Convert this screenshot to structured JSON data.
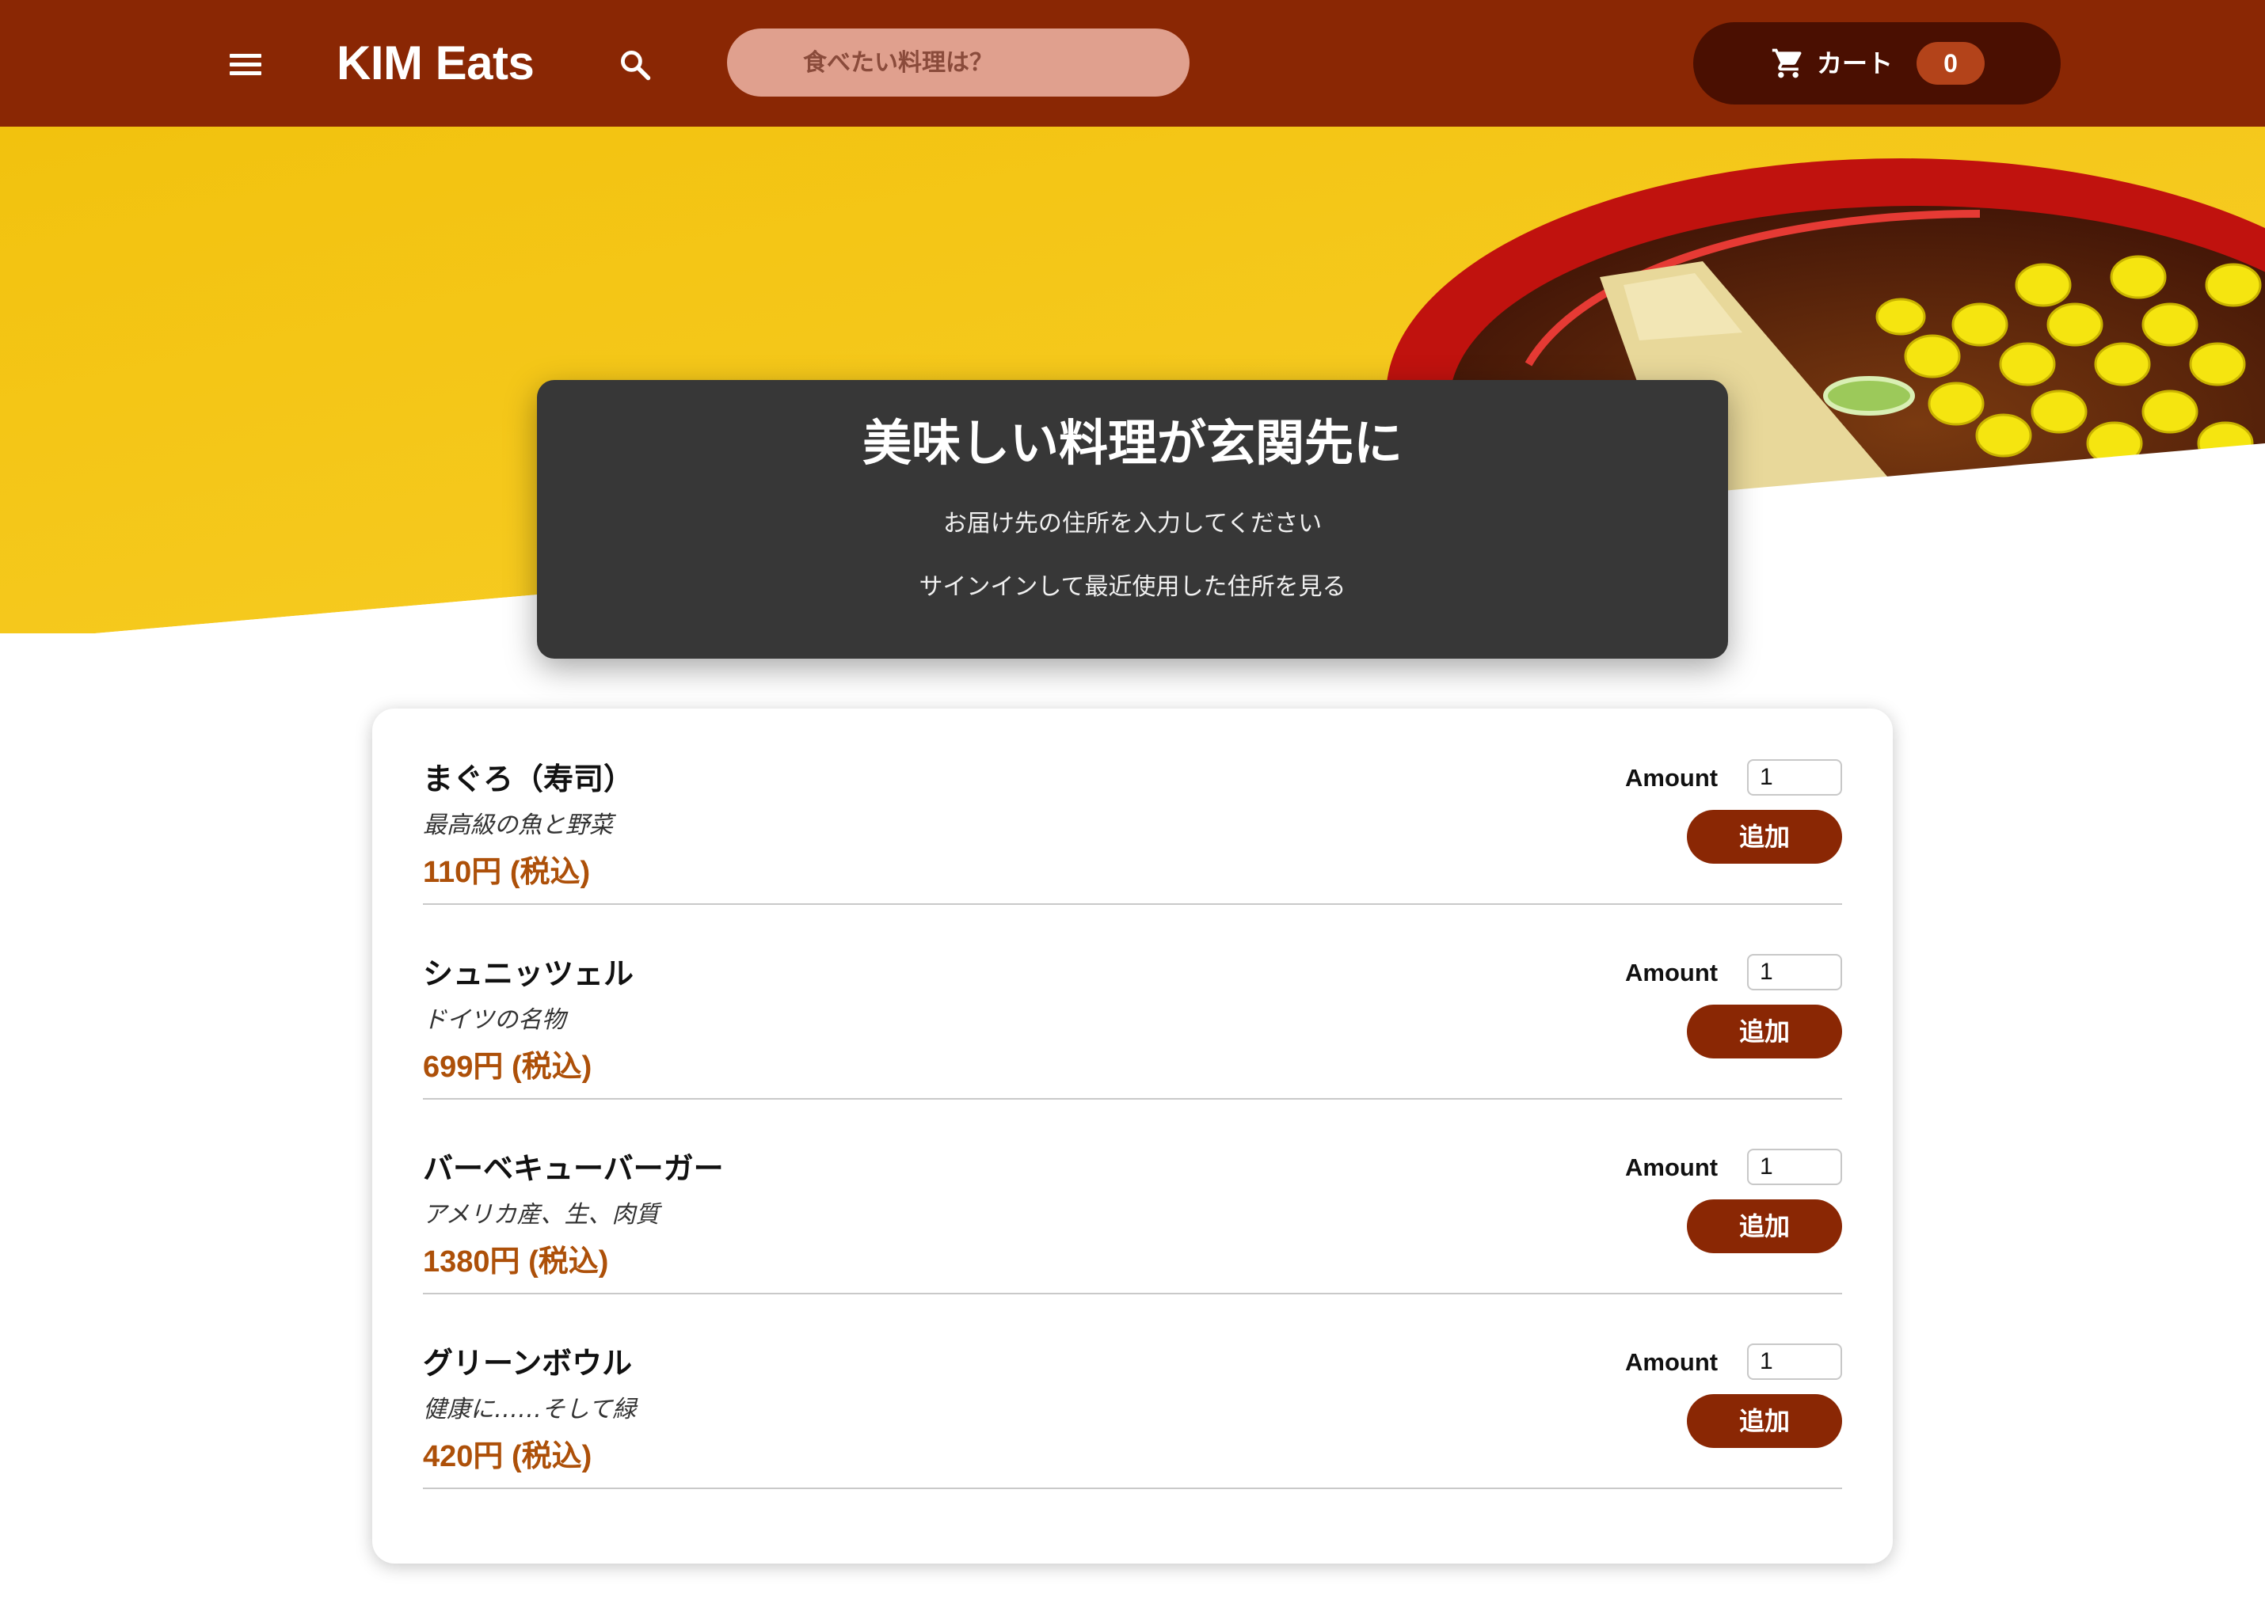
{
  "header": {
    "brand": "KIM Eats",
    "search_placeholder": "食べたい料理は？",
    "cart_label": "カート",
    "cart_count": "0",
    "colors": {
      "bar": "#8a2704",
      "cart_button": "#4a0f01",
      "badge": "#b3431a"
    }
  },
  "hero": {
    "title": "美味しい料理が玄関先に",
    "line1": "お届け先の住所を入力してください",
    "line2": "サインインして最近使用した住所を見る"
  },
  "menu": {
    "amount_label": "Amount",
    "add_label": "追加",
    "items": [
      {
        "name": "まぐろ（寿司）",
        "description": "最高級の魚と野菜",
        "price": "110円 (税込)",
        "amount": "1"
      },
      {
        "name": "シュニッツェル",
        "description": "ドイツの名物",
        "price": "699円 (税込)",
        "amount": "1"
      },
      {
        "name": "バーベキューバーガー",
        "description": "アメリカ産、生、肉質",
        "price": "1380円 (税込)",
        "amount": "1"
      },
      {
        "name": "グリーンボウル",
        "description": "健康に……そして緑",
        "price": "420円 (税込)",
        "amount": "1"
      }
    ]
  }
}
